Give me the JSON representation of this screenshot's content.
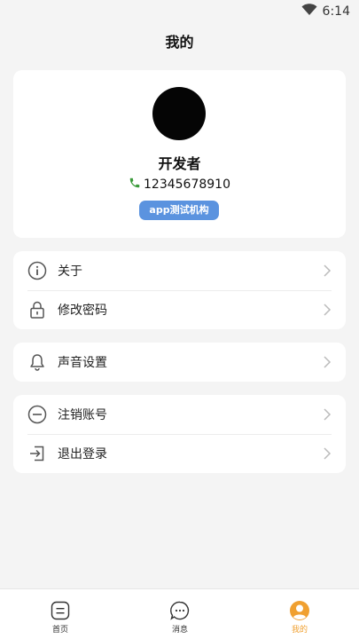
{
  "status_bar": {
    "time": "6:14",
    "wifi_icon": "wifi-icon"
  },
  "header": {
    "title": "我的"
  },
  "profile": {
    "name": "开发者",
    "phone": "12345678910",
    "org_badge": "app测试机构",
    "phone_icon": "phone-icon",
    "avatar_color": "#050505"
  },
  "menu": {
    "group1": [
      {
        "label": "关于",
        "icon": "info-icon"
      },
      {
        "label": "修改密码",
        "icon": "lock-icon"
      }
    ],
    "group2": [
      {
        "label": "声音设置",
        "icon": "bell-icon"
      }
    ],
    "group3": [
      {
        "label": "注销账号",
        "icon": "minus-circle-icon"
      },
      {
        "label": "退出登录",
        "icon": "logout-icon"
      }
    ]
  },
  "tabs": [
    {
      "label": "首页",
      "icon": "home-icon"
    },
    {
      "label": "消息",
      "icon": "message-icon"
    },
    {
      "label": "我的",
      "icon": "user-icon",
      "active": true
    }
  ],
  "colors": {
    "accent": "#f0a030",
    "badge": "#5b93df",
    "phone_icon": "#3a9a3a",
    "background": "#f4f4f4"
  }
}
